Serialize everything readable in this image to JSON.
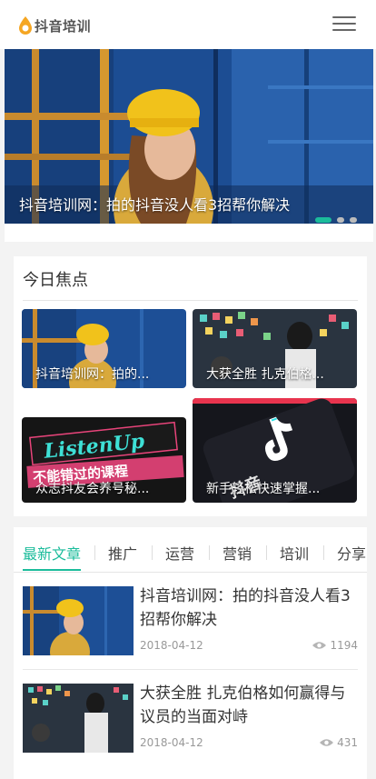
{
  "header": {
    "logo_text": "抖音培训",
    "logo_icon": "flame-drop-logo",
    "menu_icon": "hamburger-icon"
  },
  "banner": {
    "caption": "抖音培训网：拍的抖音没人看3招帮你解决",
    "slide_count": 3,
    "active_slide": 1
  },
  "focus": {
    "title": "今日焦点",
    "items": [
      {
        "caption": "抖音培训网：拍的..."
      },
      {
        "caption": "大获全胜 扎克伯格..."
      },
      {
        "caption": "众志抖友会养号秘..."
      },
      {
        "caption": "新手轻松快速掌握..."
      }
    ],
    "promo_headline": "ListenUp",
    "promo_subline": "不能错过的课程",
    "tiktok_brand": "抖音"
  },
  "news": {
    "tabs": [
      {
        "label": "最新文章",
        "active": true
      },
      {
        "label": "推广",
        "active": false
      },
      {
        "label": "运营",
        "active": false
      },
      {
        "label": "营销",
        "active": false
      },
      {
        "label": "培训",
        "active": false
      },
      {
        "label": "分享",
        "active": false
      }
    ],
    "articles": [
      {
        "title": "抖音培训网：拍的抖音没人看3招帮你解决",
        "date": "2018-04-12",
        "views": "1194"
      },
      {
        "title": "大获全胜 扎克伯格如何赢得与议员的当面对峙",
        "date": "2018-04-12",
        "views": "431"
      }
    ]
  },
  "colors": {
    "accent": "#1bbc9b",
    "page_bg": "#f3f3f3"
  }
}
